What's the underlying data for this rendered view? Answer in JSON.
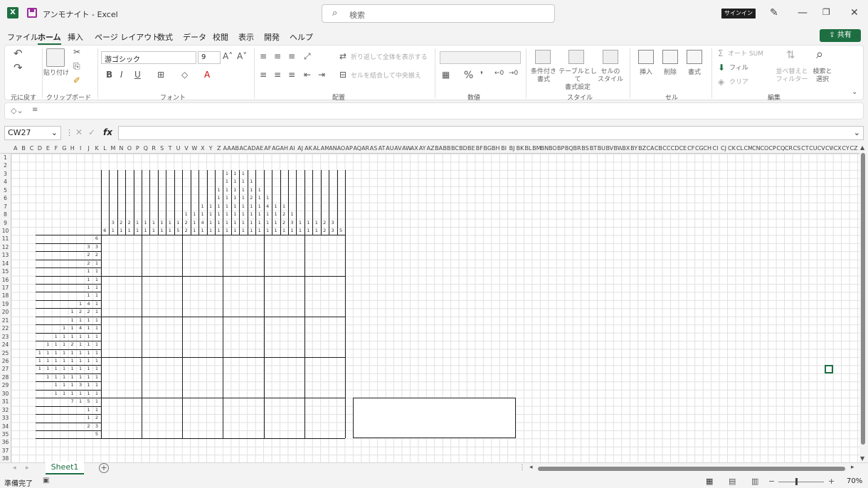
{
  "app": {
    "title": "アンモナイト - Excel",
    "search_placeholder": "検索",
    "signin": "サインイン",
    "share": "共有"
  },
  "menu": [
    "ファイル",
    "ホーム",
    "挿入",
    "ページ レイアウト",
    "数式",
    "データ",
    "校閲",
    "表示",
    "開発",
    "ヘルプ"
  ],
  "ribbon": {
    "groups": [
      "元に戻す",
      "クリップボード",
      "フォント",
      "配置",
      "数値",
      "スタイル",
      "セル",
      "編集"
    ],
    "paste": "貼り付け",
    "font_name": "游ゴシック",
    "font_size": "9",
    "wrap_text": "折り返して全体を表示する",
    "merge_center": "セルを結合して中央揃え",
    "cond_format": [
      "条件付き",
      "書式"
    ],
    "table_format": [
      "テーブルとして",
      "書式設定"
    ],
    "cell_style": [
      "セルの",
      "スタイル"
    ],
    "insert": "挿入",
    "delete": "削除",
    "format": "書式",
    "autosum": "オート SUM",
    "fill": "フィル",
    "clear": "クリア",
    "sort_filter": [
      "並べ替えと",
      "フィルター"
    ],
    "find_select": [
      "検索と",
      "選択"
    ]
  },
  "formula_bar": {
    "name_box": "CW27",
    "fx": "fx",
    "value": ""
  },
  "columns": [
    "A",
    "B",
    "C",
    "D",
    "E",
    "F",
    "G",
    "H",
    "I",
    "J",
    "K",
    "L",
    "M",
    "N",
    "O",
    "P",
    "Q",
    "R",
    "S",
    "T",
    "U",
    "V",
    "W",
    "X",
    "Y",
    "Z",
    "AA",
    "AB",
    "AC",
    "AD",
    "AE",
    "AF",
    "AG",
    "AH",
    "AI",
    "AJ",
    "AK",
    "AL",
    "AM",
    "AN",
    "AO",
    "AP",
    "AQ",
    "AR",
    "AS",
    "AT",
    "AU",
    "AV",
    "AW",
    "AX",
    "AY",
    "AZ",
    "BA",
    "BB",
    "BC",
    "BD",
    "BE",
    "BF",
    "BG",
    "BH",
    "BI",
    "BJ",
    "BK",
    "BL",
    "BM",
    "BN",
    "BO",
    "BP",
    "BQ",
    "BR",
    "BS",
    "BT",
    "BU",
    "BV",
    "BW",
    "BX",
    "BY",
    "BZ",
    "CA",
    "CB",
    "CC",
    "CD",
    "CE",
    "CF",
    "CG",
    "CH",
    "CI",
    "CJ",
    "CK",
    "CL",
    "CM",
    "CN",
    "CO",
    "CP",
    "CQ",
    "CR",
    "CS",
    "CT",
    "CU",
    "CV",
    "CW",
    "CX",
    "CY",
    "CZ"
  ],
  "rows": [
    "1",
    "2",
    "3",
    "4",
    "5",
    "6",
    "7",
    "8",
    "9",
    "10",
    "11",
    "12",
    "13",
    "14",
    "15",
    "16",
    "17",
    "18",
    "19",
    "20",
    "21",
    "22",
    "23",
    "24",
    "25",
    "26",
    "27",
    "28",
    "29",
    "30",
    "31",
    "32",
    "33",
    "34",
    "35",
    "36",
    "37",
    "38"
  ],
  "puzzle": {
    "col_clues": [
      [
        "6"
      ],
      [
        "3",
        "1"
      ],
      [
        "2",
        "1"
      ],
      [
        "2",
        "1"
      ],
      [
        "1",
        "1"
      ],
      [
        "1",
        "1"
      ],
      [
        "1",
        "1"
      ],
      [
        "1",
        "1"
      ],
      [
        "1",
        "1"
      ],
      [
        "1",
        "5"
      ],
      [
        "1",
        "2",
        "2"
      ],
      [
        "1",
        "1",
        "1"
      ],
      [
        "1",
        "1",
        "4",
        "1"
      ],
      [
        "1",
        "1",
        "1",
        "1"
      ],
      [
        "1",
        "1",
        "1",
        "1",
        "1",
        "1"
      ],
      [
        "1",
        "1",
        "1",
        "1",
        "1",
        "1",
        "1",
        "1"
      ],
      [
        "1",
        "1",
        "1",
        "1",
        "1",
        "1",
        "1",
        "1"
      ],
      [
        "1",
        "1",
        "1",
        "1",
        "1",
        "1",
        "1",
        "1"
      ],
      [
        "1",
        "1",
        "2",
        "1",
        "1",
        "1",
        "1"
      ],
      [
        "1",
        "1",
        "1",
        "1",
        "1",
        "1"
      ],
      [
        "1",
        "4",
        "1",
        "1",
        "1"
      ],
      [
        "1",
        "1",
        "1",
        "1"
      ],
      [
        "1",
        "2",
        "2",
        "1"
      ],
      [
        "1",
        "3",
        "1"
      ],
      [
        "1",
        "1"
      ],
      [
        "1",
        "1"
      ],
      [
        "1",
        "1"
      ],
      [
        "2",
        "2"
      ],
      [
        "3",
        "3"
      ],
      [
        "5"
      ]
    ],
    "row_clues": [
      [
        "6"
      ],
      [
        "3",
        "3"
      ],
      [
        "2",
        "2"
      ],
      [
        "2",
        "1"
      ],
      [
        "1",
        "1"
      ],
      [
        "1",
        "1"
      ],
      [
        "1",
        "1"
      ],
      [
        "1",
        "1"
      ],
      [
        "1",
        "4",
        "1"
      ],
      [
        "1",
        "2",
        "2",
        "1"
      ],
      [
        "1",
        "1",
        "1",
        "1"
      ],
      [
        "1",
        "1",
        "4",
        "1",
        "1"
      ],
      [
        "1",
        "1",
        "1",
        "1",
        "1",
        "1"
      ],
      [
        "1",
        "1",
        "1",
        "2",
        "1",
        "1",
        "1"
      ],
      [
        "1",
        "1",
        "1",
        "1",
        "1",
        "1",
        "1",
        "1"
      ],
      [
        "1",
        "1",
        "1",
        "1",
        "1",
        "1",
        "1",
        "1"
      ],
      [
        "1",
        "1",
        "1",
        "1",
        "1",
        "1",
        "1",
        "1"
      ],
      [
        "1",
        "1",
        "1",
        "1",
        "1",
        "1",
        "1"
      ],
      [
        "1",
        "1",
        "1",
        "3",
        "1",
        "1"
      ],
      [
        "1",
        "1",
        "1",
        "1",
        "1",
        "1"
      ],
      [
        "7",
        "1",
        "5",
        "1"
      ],
      [
        "1",
        "1"
      ],
      [
        "1",
        "2"
      ],
      [
        "2",
        "3"
      ],
      [
        "5"
      ]
    ]
  },
  "sheet_tab": "Sheet1",
  "status": {
    "ready": "準備完了",
    "zoom": "70%"
  }
}
